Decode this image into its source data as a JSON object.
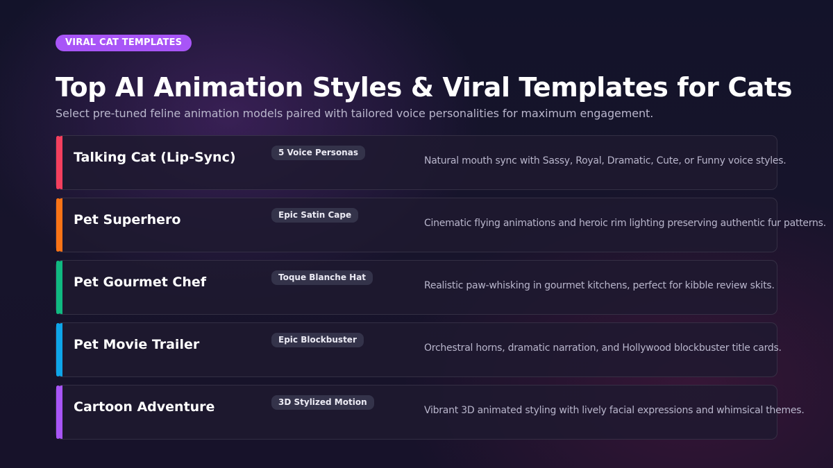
{
  "badge": "VIRAL CAT TEMPLATES",
  "title": "Top AI Animation Styles & Viral Templates for Cats",
  "subtitle": "Select pre-tuned feline animation models paired with tailored voice personalities for maximum engagement.",
  "templates": [
    {
      "name": "Talking Cat (Lip-Sync)",
      "tag": "5 Voice Personas",
      "description": "Natural mouth sync with Sassy, Royal, Dramatic, Cute, or Funny voice styles.",
      "accent": "#f43f5e"
    },
    {
      "name": "Pet Superhero",
      "tag": "Epic Satin Cape",
      "description": "Cinematic flying animations and heroic rim lighting preserving authentic fur patterns.",
      "accent": "#f97316"
    },
    {
      "name": "Pet Gourmet Chef",
      "tag": "Toque Blanche Hat",
      "description": "Realistic paw-whisking in gourmet kitchens, perfect for kibble review skits.",
      "accent": "#10b981"
    },
    {
      "name": "Pet Movie Trailer",
      "tag": "Epic Blockbuster",
      "description": "Orchestral horns, dramatic narration, and Hollywood blockbuster title cards.",
      "accent": "#0ea5e9"
    },
    {
      "name": "Cartoon Adventure",
      "tag": "3D Stylized Motion",
      "description": "Vibrant 3D animated styling with lively facial expressions and whimsical themes.",
      "accent": "#a855f7"
    }
  ]
}
